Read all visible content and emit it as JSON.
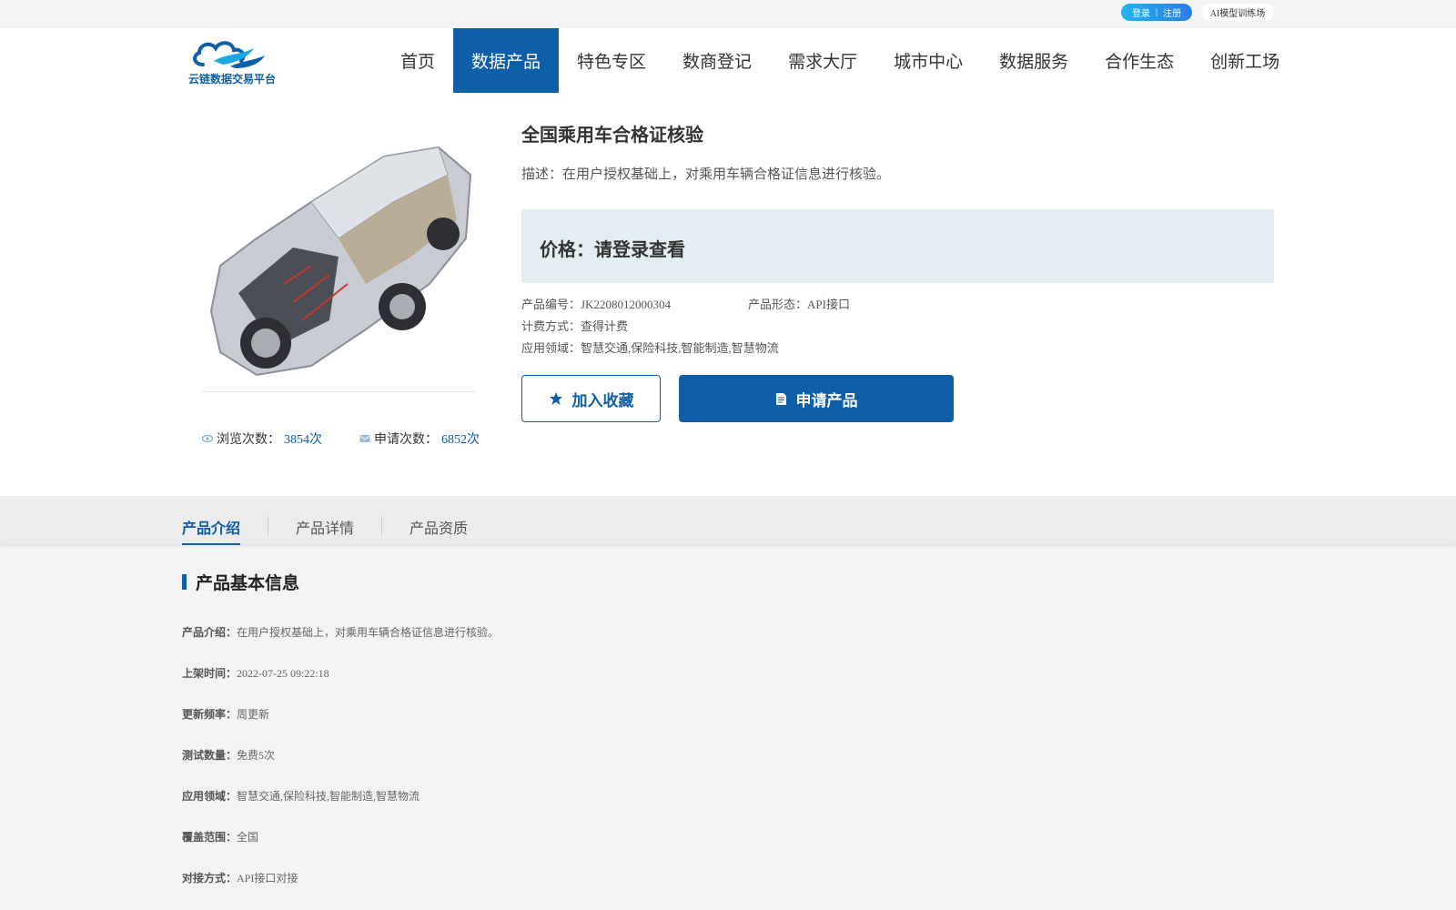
{
  "topbar": {
    "login": "登录",
    "divider": "|",
    "register": "注册",
    "ai_link": "AI模型训练场"
  },
  "logo": {
    "text": "云链数据交易平台"
  },
  "nav": [
    {
      "label": "首页",
      "active": false
    },
    {
      "label": "数据产品",
      "active": true
    },
    {
      "label": "特色专区",
      "active": false
    },
    {
      "label": "数商登记",
      "active": false
    },
    {
      "label": "需求大厅",
      "active": false
    },
    {
      "label": "城市中心",
      "active": false
    },
    {
      "label": "数据服务",
      "active": false
    },
    {
      "label": "合作生态",
      "active": false
    },
    {
      "label": "创新工场",
      "active": false
    }
  ],
  "product": {
    "title": "全国乘用车合格证核验",
    "description": "描述：在用户授权基础上，对乘用车辆合格证信息进行核验。",
    "price": "价格：请登录查看",
    "code": "产品编号：JK2208012000304",
    "form": "产品形态：API接口",
    "billing": "计费方式：查得计费",
    "domain": "应用领域：智慧交通,保险科技,智能制造,智慧物流",
    "views_label": "浏览次数：",
    "views_value": "3854次",
    "applies_label": "申请次数：",
    "applies_value": "6852次",
    "favorite_label": "加入收藏",
    "apply_label": "申请产品"
  },
  "tabs": [
    "产品介绍",
    "产品详情",
    "产品资质"
  ],
  "info": {
    "title": "产品基本信息",
    "rows": [
      {
        "label": "产品介绍：",
        "value": "在用户授权基础上，对乘用车辆合格证信息进行核验。"
      },
      {
        "label": "上架时间：",
        "value": "2022-07-25 09:22:18"
      },
      {
        "label": "更新频率：",
        "value": "周更新"
      },
      {
        "label": "测试数量：",
        "value": "免费5次"
      },
      {
        "label": "应用领域：",
        "value": "智慧交通,保险科技,智能制造,智慧物流"
      },
      {
        "label": "覆盖范围：",
        "value": "全国"
      },
      {
        "label": "对接方式：",
        "value": "API接口对接"
      }
    ]
  },
  "colors": {
    "primary": "#0e5ea8",
    "accent": "#21b3ee",
    "price_bg": "#e3eef3"
  },
  "icons": {
    "views": "eye-icon",
    "applies": "mail-icon",
    "favorite": "star-icon",
    "apply": "document-icon"
  }
}
